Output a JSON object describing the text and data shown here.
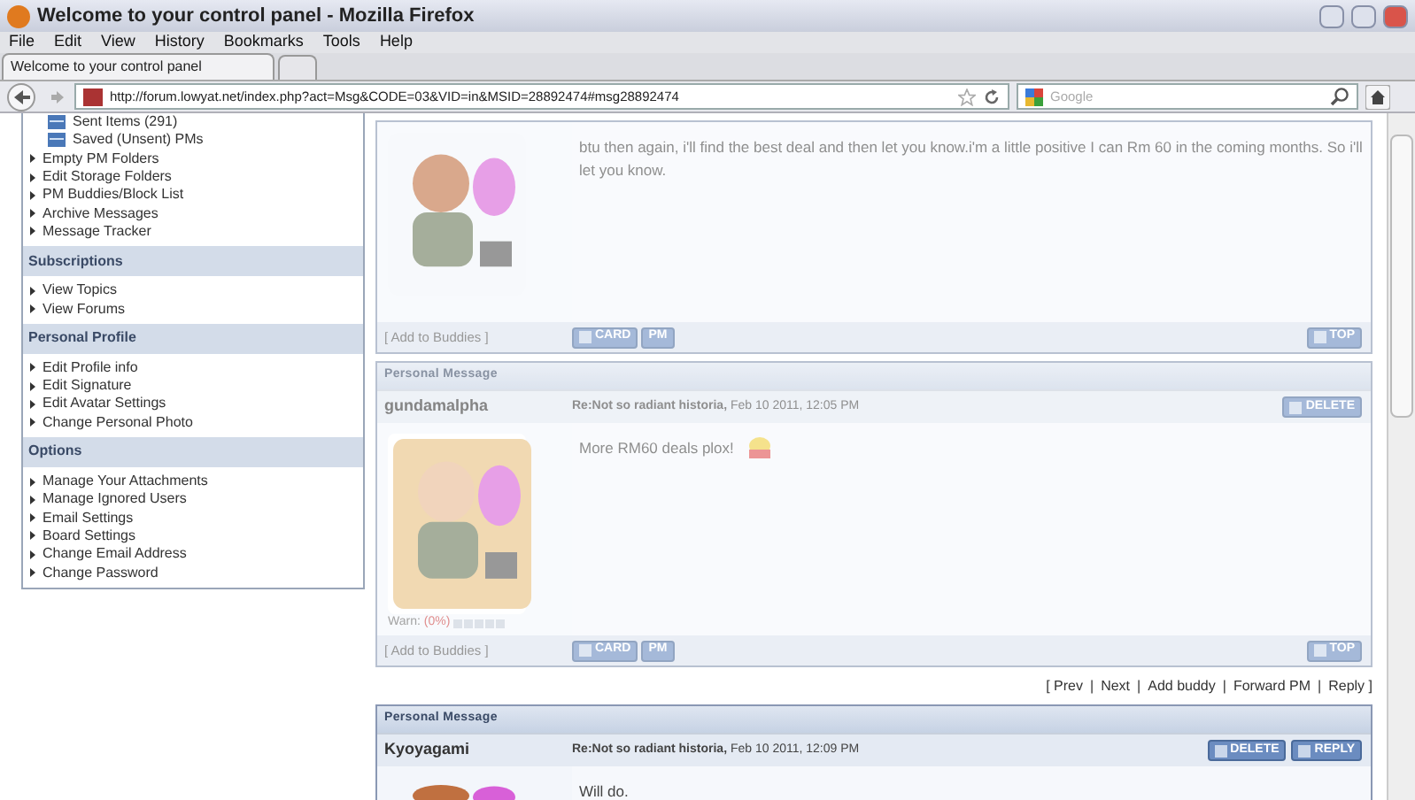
{
  "window": {
    "title": "Welcome to your control panel - Mozilla Firefox"
  },
  "menu": [
    "File",
    "Edit",
    "View",
    "History",
    "Bookmarks",
    "Tools",
    "Help"
  ],
  "tabs": [
    {
      "label": "Welcome to your control panel",
      "selected": true
    }
  ],
  "address_bar": {
    "url": "http://forum.lowyat.net/index.php?act=Msg&CODE=03&VID=in&MSID=28892474#msg28892474"
  },
  "search": {
    "placeholder": "Google"
  },
  "sidebar": {
    "top_items": [
      {
        "kind": "folder",
        "label": "Sent Items (291)"
      },
      {
        "kind": "folder",
        "label": "Saved (Unsent) PMs"
      },
      {
        "kind": "link",
        "label": "Empty PM Folders"
      },
      {
        "kind": "link",
        "label": "Edit Storage Folders"
      },
      {
        "kind": "link",
        "label": "PM Buddies/Block List"
      },
      {
        "kind": "link",
        "label": "Archive Messages"
      },
      {
        "kind": "link",
        "label": "Message Tracker"
      }
    ],
    "sections": [
      {
        "title": "Subscriptions",
        "items": [
          "View Topics",
          "View Forums"
        ]
      },
      {
        "title": "Personal Profile",
        "items": [
          "Edit Profile info",
          "Edit Signature",
          "Edit Avatar Settings",
          "Change Personal Photo"
        ]
      },
      {
        "title": "Options",
        "items": [
          "Manage Your Attachments",
          "Manage Ignored Users",
          "Email Settings",
          "Board Settings",
          "Change Email Address",
          "Change Password"
        ]
      }
    ]
  },
  "messages": [
    {
      "dimmed": true,
      "body": "btu then again, i'll find the best deal and then let you know.i'm a little positive I can Rm 60 in the coming months. So i'll let you know.",
      "add_buddy": "[ Add to Buddies ]",
      "footer_buttons": [
        "CARD",
        "PM"
      ],
      "top_button": "TOP"
    },
    {
      "dimmed": true,
      "header": "Personal Message",
      "author": "gundamalpha",
      "subject": "Re:Not so radiant historia,",
      "date": "Feb 10 2011, 12:05 PM",
      "actions": [
        "DELETE"
      ],
      "body": "More RM60 deals plox!",
      "warn_label": "Warn:",
      "warn_value": "(0%)",
      "add_buddy": "[ Add to Buddies ]",
      "footer_buttons": [
        "CARD",
        "PM"
      ],
      "top_button": "TOP"
    },
    {
      "dimmed": false,
      "links": [
        "[ Prev",
        "|",
        "Next",
        "|",
        "Add buddy",
        "|",
        "Forward PM",
        "|",
        "Reply ]"
      ],
      "header": "Personal Message",
      "author": "Kyoyagami",
      "subject": "Re:Not so radiant historia,",
      "date": "Feb 10 2011, 12:09 PM",
      "actions": [
        "DELETE",
        "REPLY"
      ],
      "body": "Will do."
    }
  ]
}
